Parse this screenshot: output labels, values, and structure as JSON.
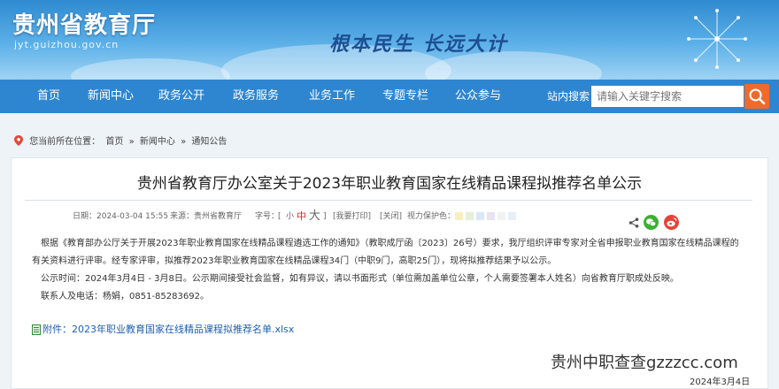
{
  "header": {
    "site_title": "贵州省教育厅",
    "site_url": "jyt.guizhou.gov.cn",
    "slogan": "根本民生 长远大计"
  },
  "nav": {
    "items": [
      "首页",
      "新闻中心",
      "政务公开",
      "政务服务",
      "业务工作",
      "专题专栏",
      "公众参与"
    ],
    "search_label": "站内搜索：",
    "search_placeholder": "请输入关键字搜索"
  },
  "breadcrumb": {
    "prefix": "您当前所在位置：",
    "items": [
      "首页",
      "»",
      "新闻中心",
      "»",
      "通知公告"
    ]
  },
  "article": {
    "title": "贵州省教育厅办公室关于2023年职业教育国家在线精品课程拟推荐名单公示",
    "date": "日期：2024-03-04 15:55",
    "source": "来源：贵州省教育厅",
    "fontsize_label": "字号：",
    "font_small": "小",
    "font_medium": "中",
    "font_large": "大",
    "print_label": "[我要打印]",
    "close_label": "[关闭]",
    "eye_label": "视力保护色：",
    "paragraphs": [
      "根据《教育部办公厅关于开展2023年职业教育国家在线精品课程遴选工作的通知》（教职成厅函〔2023〕26号）要求，我厅组织评审专家对全省申报职业教育国家在线精品课程的",
      "有关资料进行评审。经专家评审，拟推荐2023年职业教育国家在线精品课程34门（中职9门，高职25门），现将拟推荐结果予以公示。",
      "公示时间：2024年3月4日 - 3月8日。公示期间接受社会监督，如有异议，请以书面形式（单位需加盖单位公章，个人需要签署本人姓名）向省教育厅职成处反映。",
      "联系人及电话：杨娟，0851-85283692。"
    ],
    "attachment": "附件：2023年职业教育国家在线精品课程拟推荐名单.xlsx"
  },
  "watermark": "贵州中职查查gzzzcc.com",
  "footer_date": "2024年3月4日",
  "colors": {
    "nav": "#2e86d1",
    "search_button": "#f06a2c",
    "font_medium": "#d9251c",
    "link": "#1d5fb3",
    "eye_swatches": [
      "#fbeec1",
      "#e3f0d6",
      "#dbe7f5",
      "#e9e2f2",
      "#f2f2f2",
      "#e7eef6"
    ]
  },
  "icons": [
    "location-icon",
    "search-icon",
    "share-icon",
    "wechat-icon",
    "weibo-icon",
    "attachment-icon"
  ]
}
